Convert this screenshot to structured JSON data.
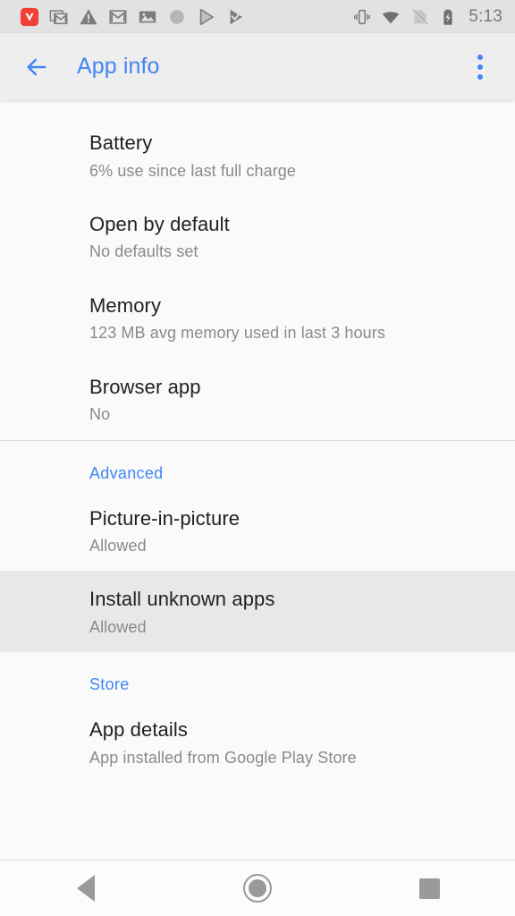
{
  "status_bar": {
    "time": "5:13",
    "left_icons": [
      {
        "name": "vivaldi-icon",
        "label": "V"
      },
      {
        "name": "gmail-stack-icon",
        "label": "Gmail notifications"
      },
      {
        "name": "warning-triangle-icon",
        "label": "Warning"
      },
      {
        "name": "gmail-icon",
        "label": "Gmail"
      },
      {
        "name": "photo-icon",
        "label": "Photo"
      },
      {
        "name": "circle-icon",
        "label": "Circle"
      },
      {
        "name": "play-store-icon",
        "label": "Play Store"
      },
      {
        "name": "play-check-icon",
        "label": "Play Protect"
      }
    ],
    "right_icons": [
      {
        "name": "vibrate-icon",
        "label": "Vibrate"
      },
      {
        "name": "wifi-icon",
        "label": "Wi-Fi"
      },
      {
        "name": "no-sim-icon",
        "label": "No SIM"
      },
      {
        "name": "battery-charging-icon",
        "label": "Charging"
      }
    ]
  },
  "app_bar": {
    "title": "App info",
    "back_icon": "arrow-back-icon",
    "overflow_icon": "more-vert-icon",
    "accent_color": "#4285f4"
  },
  "sections": [
    {
      "header": null,
      "items": [
        {
          "title": "Battery",
          "subtitle": "6% use since last full charge",
          "highlighted": false
        },
        {
          "title": "Open by default",
          "subtitle": "No defaults set",
          "highlighted": false
        },
        {
          "title": "Memory",
          "subtitle": "123 MB avg memory used in last 3 hours",
          "highlighted": false
        },
        {
          "title": "Browser app",
          "subtitle": "No",
          "highlighted": false
        }
      ]
    },
    {
      "header": "Advanced",
      "items": [
        {
          "title": "Picture-in-picture",
          "subtitle": "Allowed",
          "highlighted": false
        },
        {
          "title": "Install unknown apps",
          "subtitle": "Allowed",
          "highlighted": true
        }
      ]
    },
    {
      "header": "Store",
      "items": [
        {
          "title": "App details",
          "subtitle": "App installed from Google Play Store",
          "highlighted": false
        }
      ]
    }
  ],
  "nav_bar": {
    "back_label": "Back",
    "home_label": "Home",
    "recents_label": "Recents"
  },
  "colors": {
    "accent": "#4285f4",
    "status_bar_bg": "#e2e2e2",
    "app_bar_bg": "#eeeeee",
    "page_bg": "#fafafa",
    "highlight_bg": "#e8e8e8",
    "title_text": "#212121",
    "subtitle_text": "#8a8a8a"
  }
}
